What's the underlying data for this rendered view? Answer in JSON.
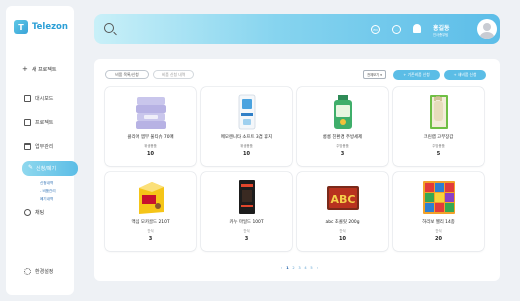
{
  "app": {
    "logo_letter": "T",
    "name": "Telezon"
  },
  "sidebar": {
    "new_project": "새 프로젝트",
    "items": [
      {
        "label": "대시보드"
      },
      {
        "label": "프로젝트"
      },
      {
        "label": "업무관리"
      }
    ],
    "active": {
      "label": "신청/폐기"
    },
    "sub_items": [
      "신청내역",
      "- 비품관리",
      "폐기내역"
    ],
    "chat": "채팅",
    "settings": "환경설정"
  },
  "topbar": {
    "user_name": "홍길동",
    "user_role": "인사총무팀",
    "icon_left": "EN",
    "icon_mid": "···"
  },
  "toolbar": {
    "chip_inventory": "비품 목록/신청",
    "chip_history": "비품 신청 내역",
    "sort": "전체보기 ▾",
    "btn_general": "+ 기존비품 신청",
    "btn_new": "+ 새비품 신청"
  },
  "products": [
    {
      "name": "클리어 앱부 물티슈 70매",
      "category": "위생용품",
      "qty": "10"
    },
    {
      "name": "메모렌니타 소프트 3겹 휴지",
      "category": "위생용품",
      "qty": "10"
    },
    {
      "name": "롱롱 친환경 주방세제",
      "category": "주방용품",
      "qty": "3"
    },
    {
      "name": "크린랩 고무장갑",
      "category": "주방용품",
      "qty": "5"
    },
    {
      "name": "맥심 모카골드 210T",
      "category": "간식",
      "qty": "3"
    },
    {
      "name": "카누 마일드 100T",
      "category": "간식",
      "qty": "3"
    },
    {
      "name": "abc 초콜릿 200g",
      "category": "간식",
      "qty": "10"
    },
    {
      "name": "하리보 젤리 14종",
      "category": "간식",
      "qty": "20"
    }
  ],
  "pagination": [
    "‹",
    "1",
    "2",
    "3",
    "4",
    "5",
    "›"
  ],
  "colors": {
    "accent": "#5bbde6",
    "brand": "#2b9fd6"
  }
}
